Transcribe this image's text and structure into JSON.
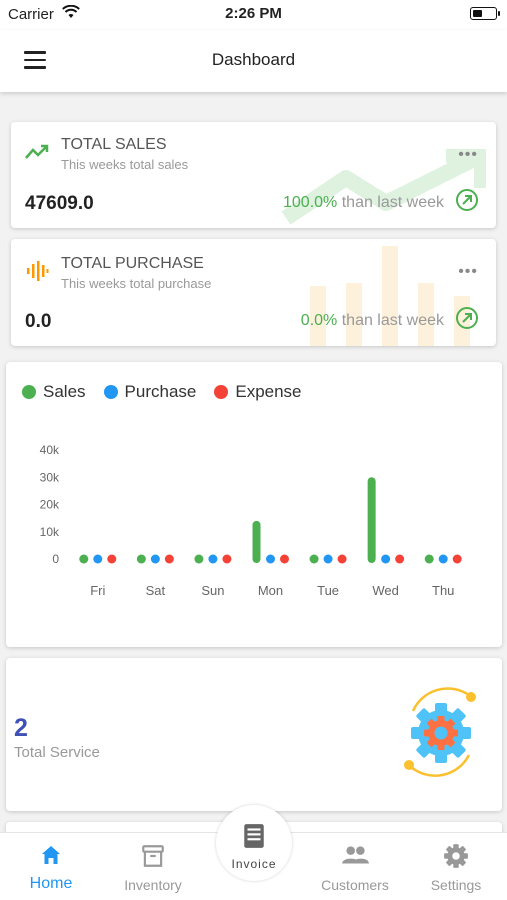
{
  "status_bar": {
    "carrier": "Carrier",
    "time": "2:26 PM"
  },
  "header": {
    "title": "Dashboard"
  },
  "total_sales": {
    "title": "TOTAL SALES",
    "subtitle": "This weeks total sales",
    "value": "47609.0",
    "change_pct": "100.0%",
    "change_text": "than last week",
    "more": "•••",
    "icon": "trending-up-icon"
  },
  "total_purchase": {
    "title": "TOTAL PURCHASE",
    "subtitle": "This weeks total purchase",
    "value": "0.0",
    "change_pct": "0.0%",
    "change_text": "than last week",
    "more": "•••",
    "icon": "equalizer-icon"
  },
  "chart_data": {
    "type": "bar",
    "categories": [
      "Fri",
      "Sat",
      "Sun",
      "Mon",
      "Tue",
      "Wed",
      "Thu"
    ],
    "series": [
      {
        "name": "Sales",
        "color": "#4caf50",
        "values": [
          0,
          0,
          0,
          14000,
          0,
          30000,
          0
        ]
      },
      {
        "name": "Purchase",
        "color": "#2196f3",
        "values": [
          0,
          0,
          0,
          0,
          0,
          0,
          0
        ]
      },
      {
        "name": "Expense",
        "color": "#f44336",
        "values": [
          0,
          0,
          0,
          0,
          0,
          0,
          0
        ]
      }
    ],
    "y_ticks": [
      "0",
      "10k",
      "20k",
      "30k",
      "40k"
    ],
    "ylim": [
      0,
      40000
    ],
    "legend": "top-left",
    "grid": false
  },
  "service": {
    "count": "2",
    "label": "Total Service",
    "icon": "settings-gear-icon"
  },
  "tabs": [
    {
      "label": "Home",
      "icon": "home-icon",
      "active": true
    },
    {
      "label": "Inventory",
      "icon": "archive-box-icon",
      "active": false
    },
    {
      "label": "Invoice",
      "icon": "receipt-icon",
      "active": false
    },
    {
      "label": "Customers",
      "icon": "people-icon",
      "active": false
    },
    {
      "label": "Settings",
      "icon": "gear-icon",
      "active": false
    }
  ],
  "colors": {
    "accent": "#2196f3",
    "positive": "#4caf50",
    "purchase_icon": "#ff9800",
    "service_count": "#3f51b5"
  }
}
